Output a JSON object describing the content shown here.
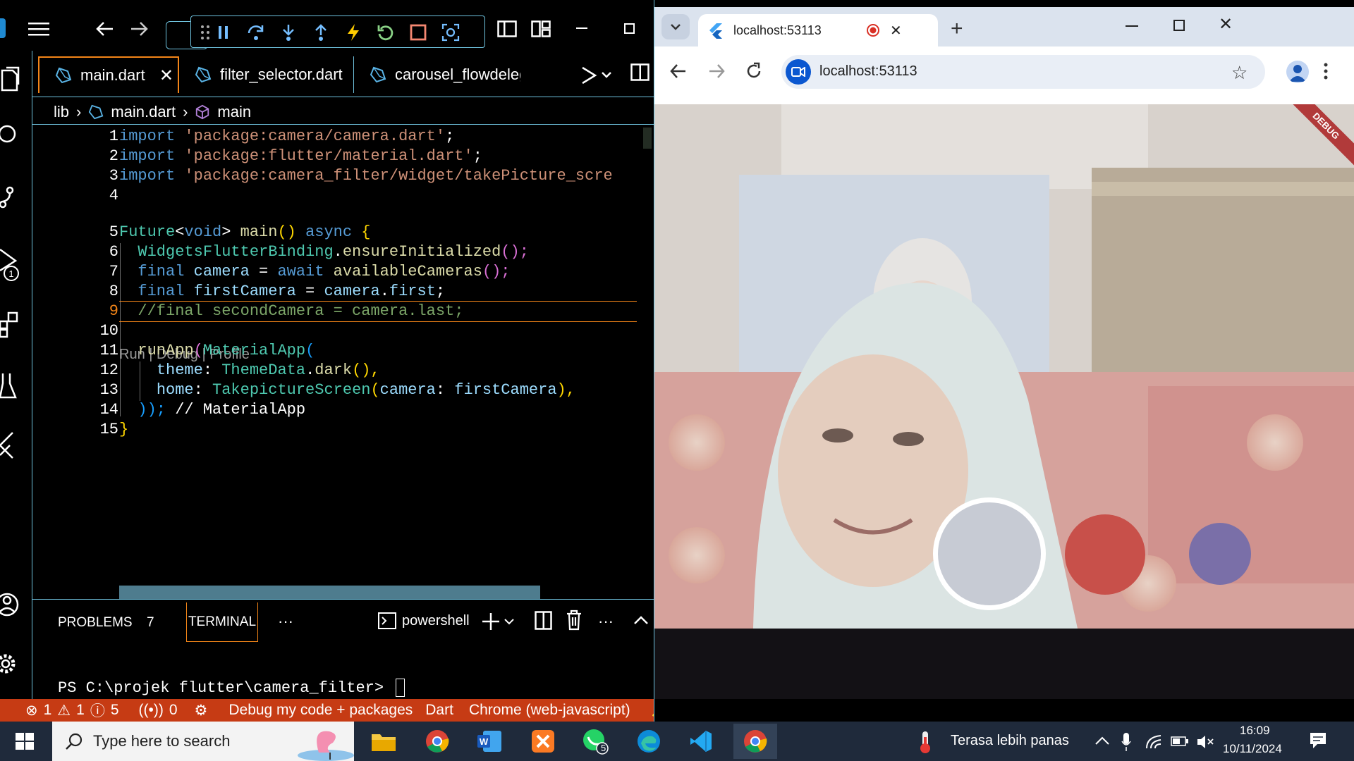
{
  "vscode": {
    "tabs": [
      {
        "label": "main.dart",
        "active": true
      },
      {
        "label": "filter_selector.dart",
        "active": false
      },
      {
        "label": "carousel_flowdeleg",
        "active": false
      }
    ],
    "breadcrumb": {
      "folder": "lib",
      "file": "main.dart",
      "symbol": "main"
    },
    "line_numbers": [
      "1",
      "2",
      "3",
      "4",
      "5",
      "6",
      "7",
      "8",
      "9",
      "10",
      "11",
      "12",
      "13",
      "14",
      "15"
    ],
    "codelens": "Run | Debug | Profile",
    "code": {
      "l1_kw": "import",
      "l1_str": "'package:camera/camera.dart'",
      "l1_end": ";",
      "l2_kw": "import",
      "l2_str": "'package:flutter/material.dart'",
      "l2_end": ";",
      "l3_kw": "import",
      "l3_str": "'package:camera_filter/widget/takePicture_scre",
      "l5_ty": "Future",
      "l5_lt": "<",
      "l5_kw": "void",
      "l5_gt": ">",
      "l5_fn": "main",
      "l5_paren": "()",
      "l5_async": "async",
      "l5_brace": "{",
      "l6_ty": "WidgetsFlutterBinding",
      "l6_dot": ".",
      "l6_fn": "ensureInitialized",
      "l6_end": "();",
      "l7_kw": "final",
      "l7_var": "camera",
      "l7_eq": " = ",
      "l7_await": "await",
      "l7_fn": "availableCameras",
      "l7_end": "();",
      "l8_kw": "final",
      "l8_var": "firstCamera",
      "l8_eq": " = ",
      "l8_var2": "camera",
      "l8_dot": ".",
      "l8_prop": "first",
      "l8_end": ";",
      "l9_comment": "//final secondCamera = camera.last;",
      "l11_fn": "runApp",
      "l11_p": "(",
      "l11_ty": "MaterialApp",
      "l11_p2": "(",
      "l12_prop": "theme",
      "l12_colon": ": ",
      "l12_ty": "ThemeData",
      "l12_dot": ".",
      "l12_fn": "dark",
      "l12_end": "(),",
      "l13_prop": "home",
      "l13_colon": ": ",
      "l13_ty": "TakepictureScreen",
      "l13_p": "(",
      "l13_arg": "camera",
      "l13_colon2": ": ",
      "l13_var": "firstCamera",
      "l13_end": "),",
      "l14_close": "));",
      "l14_comment": " // MaterialApp",
      "l15_brace": "}"
    },
    "panel": {
      "problems_label": "PROBLEMS",
      "problems_count": "7",
      "terminal_label": "TERMINAL",
      "more": "···",
      "shell": "powershell",
      "prompt": "PS C:\\projek flutter\\camera_filter> "
    },
    "status": {
      "errors": "1",
      "warnings": "1",
      "infos": "5",
      "ports": "0",
      "debug_config": "Debug my code + packages",
      "language": "Dart",
      "device": "Chrome (web-javascript)"
    }
  },
  "chrome": {
    "tab_title": "localhost:53113",
    "url": "localhost:53113",
    "debug_banner": "DEBUG",
    "filters": [
      {
        "name": "none",
        "color": "#c7cbd4",
        "selected": true
      },
      {
        "name": "red",
        "color": "#c8504a",
        "selected": false
      },
      {
        "name": "purple",
        "color": "#7a6fa8",
        "selected": false
      }
    ]
  },
  "taskbar": {
    "search_placeholder": "Type here to search",
    "weather": "Terasa lebih panas",
    "whatsapp_badge": "5",
    "time": "16:09",
    "date": "10/11/2024"
  }
}
